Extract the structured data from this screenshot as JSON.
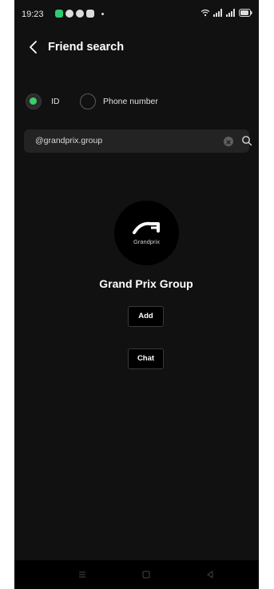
{
  "status_bar": {
    "time": "19:23"
  },
  "header": {
    "title": "Friend search"
  },
  "search_type": {
    "options": [
      {
        "label": "ID",
        "selected": true
      },
      {
        "label": "Phone number",
        "selected": false
      }
    ]
  },
  "search": {
    "value": "@grandprix.group"
  },
  "result": {
    "avatar_text": "Grandprix",
    "name": "Grand Prix Group",
    "add_label": "Add",
    "chat_label": "Chat"
  },
  "colors": {
    "accent": "#3ccf6c",
    "background": "#111111"
  }
}
